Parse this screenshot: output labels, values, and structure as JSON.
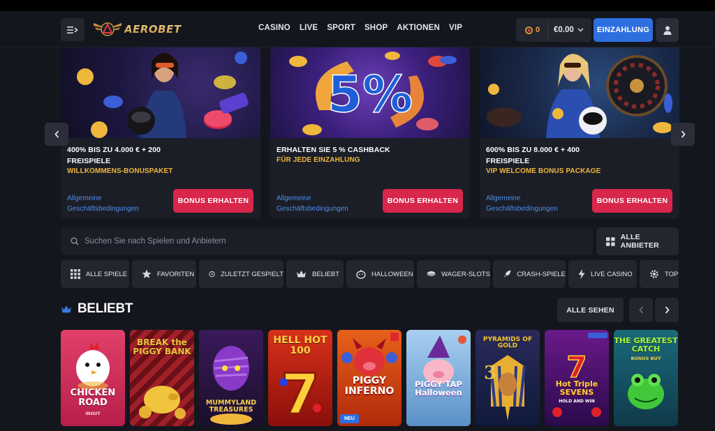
{
  "header": {
    "logo_text": "AEROBET",
    "nav": [
      "CASINO",
      "LIVE",
      "SPORT",
      "SHOP",
      "AKTIONEN",
      "VIP"
    ],
    "coins": "0",
    "balance": "€0.00",
    "deposit_label": "EINZAHLUNG"
  },
  "promos": [
    {
      "title_line1": "400% BIS ZU 4.000 € + 200",
      "title_line2": "FREISPIELE",
      "subtitle": "WILLKOMMENS-BONUSPAKET",
      "terms_line1": "Allgemeine",
      "terms_line2": "Geschäftsbedingungen",
      "button": "BONUS ERHALTEN"
    },
    {
      "title_line1": "ERHALTEN SIE 5 % CASHBACK",
      "title_line2": "",
      "subtitle": "FÜR JEDE EINZAHLUNG",
      "terms_line1": "Allgemeine",
      "terms_line2": "Geschäftsbedingungen",
      "button": "BONUS ERHALTEN",
      "image_text": "5%"
    },
    {
      "title_line1": "600% BIS ZU 8.000 € + 400",
      "title_line2": "FREISPIELE",
      "subtitle": "VIP WELCOME BONUS PACKAGE",
      "terms_line1": "Allgemeine",
      "terms_line2": "Geschäftsbedingungen",
      "button": "BONUS ERHALTEN"
    }
  ],
  "search": {
    "placeholder": "Suchen Sie nach Spielen und Anbietern",
    "providers_label": "ALLE ANBIETER"
  },
  "categories": [
    {
      "label": "ALLE SPIELE",
      "icon": "grid-icon"
    },
    {
      "label": "FAVORITEN",
      "icon": "star-icon"
    },
    {
      "label": "ZULETZT GESPIELT",
      "icon": "history-icon"
    },
    {
      "label": "BELIEBT",
      "icon": "crown-icon"
    },
    {
      "label": "HALLOWEEN",
      "icon": "pumpkin-icon"
    },
    {
      "label": "WAGER-SLOTS",
      "icon": "chip-icon"
    },
    {
      "label": "CRASH-SPIELE",
      "icon": "rocket-icon"
    },
    {
      "label": "LIVE CASINO",
      "icon": "lightning-icon"
    },
    {
      "label": "TOP",
      "icon": "gear-icon"
    }
  ],
  "section": {
    "title": "BELIEBT",
    "see_all": "ALLE SEHEN"
  },
  "games": [
    {
      "title": "CHICKEN ROAD",
      "sub": "INOUT",
      "badge": ""
    },
    {
      "title": "BREAK the PIGGY BANK",
      "sub": "",
      "badge": ""
    },
    {
      "title": "MUMMYLAND TREASURES",
      "sub": "",
      "badge": ""
    },
    {
      "title": "HELL HOT 100",
      "sub": "",
      "badge": ""
    },
    {
      "title": "PIGGY INFERNO",
      "sub": "",
      "badge": "NEU"
    },
    {
      "title": "PIGGY TAP Halloween",
      "sub": "",
      "badge": ""
    },
    {
      "title": "PYRAMIDS OF GOLD",
      "sub": "",
      "badge": ""
    },
    {
      "title": "Hot Triple SEVENS",
      "sub": "HOLD AND WIN",
      "badge": ""
    },
    {
      "title": "THE GREATEST CATCH",
      "sub": "BONUS BUY",
      "badge": ""
    }
  ],
  "colors": {
    "background": "#14161e",
    "panel": "#1b1e27",
    "button": "#23262f",
    "accent_blue": "#2e6fe0",
    "accent_red": "#d8274a",
    "accent_gold": "#f0b73d",
    "link": "#4f8ee8"
  }
}
